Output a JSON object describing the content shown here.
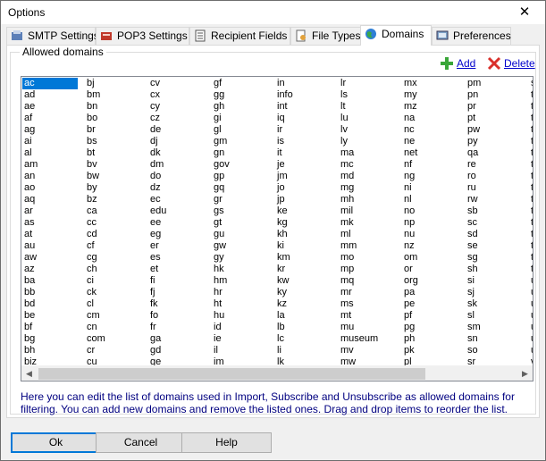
{
  "window": {
    "title": "Options",
    "close_glyph": "✕"
  },
  "tabs": [
    {
      "label": "SMTP Settings",
      "icon": "smtp-settings-icon",
      "active": false
    },
    {
      "label": "POP3 Settings",
      "icon": "pop3-settings-icon",
      "active": false
    },
    {
      "label": "Recipient Fields",
      "icon": "recipient-fields-icon",
      "active": false
    },
    {
      "label": "File Types",
      "icon": "file-types-icon",
      "active": false
    },
    {
      "label": "Domains",
      "icon": "globe-icon",
      "active": true
    },
    {
      "label": "Preferences",
      "icon": "preferences-icon",
      "active": false
    }
  ],
  "domains_panel": {
    "group_label": "Allowed domains",
    "add_label": "Add",
    "delete_label": "Delete",
    "help_text": "Here you can edit the list of domains used in Import, Subscribe and Unsubscribe as allowed domains for filtering. You can add new domains and remove the listed ones. Drag and drop items to reorder the list."
  },
  "domain_columns": [
    [
      "ac",
      "ad",
      "ae",
      "af",
      "ag",
      "ai",
      "al",
      "am",
      "an",
      "ao",
      "aq",
      "ar",
      "as",
      "at",
      "au",
      "aw",
      "az",
      "ba",
      "bb",
      "bd",
      "be",
      "bf",
      "bg",
      "bh",
      "biz"
    ],
    [
      "bj",
      "bm",
      "bn",
      "bo",
      "br",
      "bs",
      "bt",
      "bv",
      "bw",
      "by",
      "bz",
      "ca",
      "cc",
      "cd",
      "cf",
      "cg",
      "ch",
      "ci",
      "ck",
      "cl",
      "cm",
      "cn",
      "com",
      "cr",
      "cu"
    ],
    [
      "cv",
      "cx",
      "cy",
      "cz",
      "de",
      "dj",
      "dk",
      "dm",
      "do",
      "dz",
      "ec",
      "edu",
      "ee",
      "eg",
      "er",
      "es",
      "et",
      "fi",
      "fj",
      "fk",
      "fo",
      "fr",
      "ga",
      "gd",
      "ge"
    ],
    [
      "gf",
      "gg",
      "gh",
      "gi",
      "gl",
      "gm",
      "gn",
      "gov",
      "gp",
      "gq",
      "gr",
      "gs",
      "gt",
      "gu",
      "gw",
      "gy",
      "hk",
      "hm",
      "hr",
      "ht",
      "hu",
      "id",
      "ie",
      "il",
      "im"
    ],
    [
      "in",
      "info",
      "int",
      "iq",
      "ir",
      "is",
      "it",
      "je",
      "jm",
      "jo",
      "jp",
      "ke",
      "kg",
      "kh",
      "ki",
      "km",
      "kr",
      "kw",
      "ky",
      "kz",
      "la",
      "lb",
      "lc",
      "li",
      "lk"
    ],
    [
      "lr",
      "ls",
      "lt",
      "lu",
      "lv",
      "ly",
      "ma",
      "mc",
      "md",
      "mg",
      "mh",
      "mil",
      "mk",
      "ml",
      "mm",
      "mo",
      "mp",
      "mq",
      "mr",
      "ms",
      "mt",
      "mu",
      "museum",
      "mv",
      "mw"
    ],
    [
      "mx",
      "my",
      "mz",
      "na",
      "nc",
      "ne",
      "net",
      "nf",
      "ng",
      "ni",
      "nl",
      "no",
      "np",
      "nu",
      "nz",
      "om",
      "or",
      "org",
      "pa",
      "pe",
      "pf",
      "pg",
      "ph",
      "pk",
      "pl"
    ],
    [
      "pm",
      "pn",
      "pr",
      "pt",
      "pw",
      "py",
      "qa",
      "re",
      "ro",
      "ru",
      "rw",
      "sb",
      "sc",
      "sd",
      "se",
      "sg",
      "sh",
      "si",
      "sj",
      "sk",
      "sl",
      "sm",
      "sn",
      "so",
      "sr"
    ],
    [
      "st",
      "tc",
      "td",
      "tf",
      "tg",
      "th",
      "tj",
      "tk",
      "tm",
      "tn",
      "to",
      "tp",
      "tr",
      "tt",
      "tv",
      "tw",
      "tz",
      "ua",
      "ug",
      "uk",
      "um",
      "us",
      "uy",
      "uz",
      "va"
    ]
  ],
  "selected_domain": "ac",
  "scrollbar": {
    "left_arrow": "◀",
    "right_arrow": "▶"
  },
  "buttons": {
    "ok_label": "Ok",
    "cancel_label": "Cancel",
    "help_label": "Help"
  },
  "colors": {
    "selection": "#0078d7",
    "help_text": "#000080",
    "link": "#0000cc"
  }
}
